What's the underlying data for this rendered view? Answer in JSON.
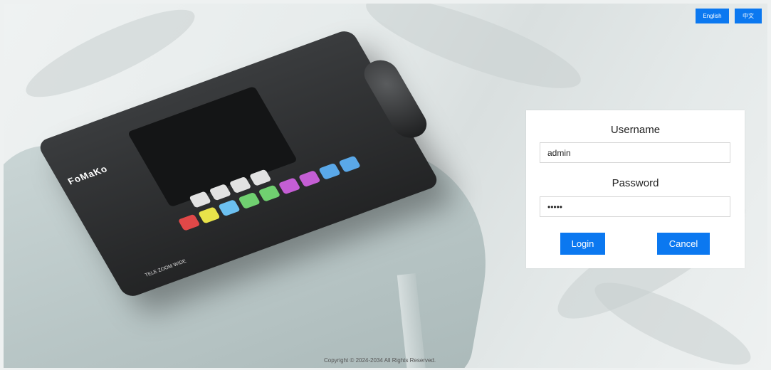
{
  "header": {
    "lang_english": "English",
    "lang_chinese": "中文"
  },
  "login": {
    "username_label": "Username",
    "username_value": "admin",
    "password_label": "Password",
    "password_value": "12345",
    "login_button": "Login",
    "cancel_button": "Cancel"
  },
  "footer": {
    "copyright": "Copyright © 2024-2034 All Rights Reserved."
  },
  "background": {
    "brand_text": "FoMaKo",
    "zoom_labels": "TELE  ZOOM  WIDE"
  },
  "colors": {
    "accent": "#0b78f0"
  }
}
